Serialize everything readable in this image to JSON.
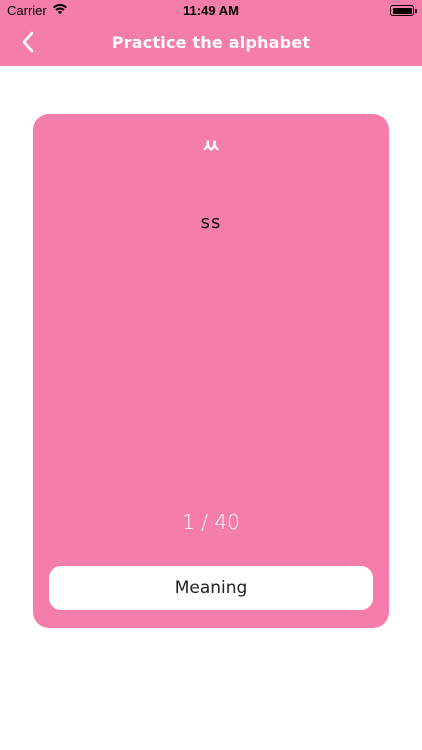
{
  "status_bar": {
    "carrier": "Carrier",
    "time": "11:49 AM"
  },
  "nav": {
    "title": "Practice the alphabet",
    "back_icon": "chevron-left-icon"
  },
  "card": {
    "glyph": "ㅆ",
    "romanization": "ss",
    "counter": "1 / 40",
    "meaning_button_label": "Meaning"
  },
  "colors": {
    "accent": "#f47dab",
    "button_bg": "#ffffff"
  },
  "icons": {
    "wifi": "wifi-icon",
    "battery": "battery-icon"
  }
}
